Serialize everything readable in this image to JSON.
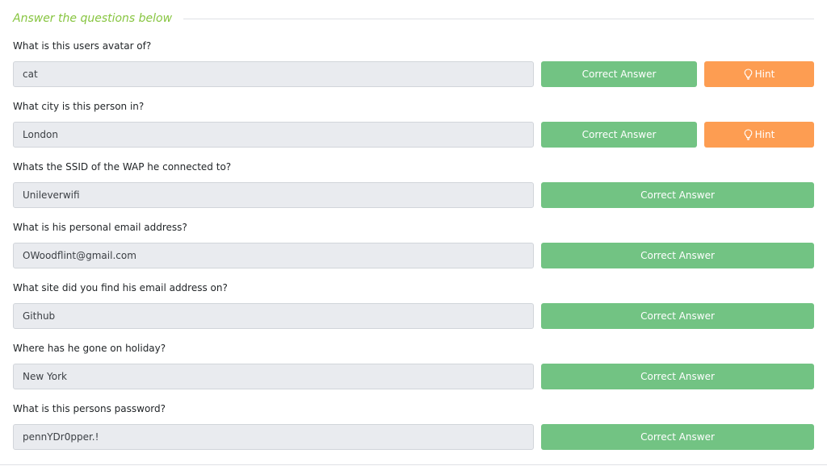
{
  "section": {
    "title": "Answer the questions below"
  },
  "colors": {
    "accent": "#87c540",
    "correct": "#72c383",
    "hint": "#fd9d52",
    "field_bg": "#e9ebef"
  },
  "questions": [
    {
      "text": "What is this users avatar of?",
      "answer": "cat",
      "correct_label": "Correct Answer",
      "hint_label": "Hint",
      "hint_icon": "lightbulb-icon"
    },
    {
      "text": "What city is this person in?",
      "answer": "London",
      "correct_label": "Correct Answer",
      "hint_label": "Hint",
      "hint_icon": "lightbulb-icon"
    },
    {
      "text": "Whats the SSID of the WAP he connected to?",
      "answer": "Unileverwifi",
      "correct_label": "Correct Answer"
    },
    {
      "text": "What is his personal email address?",
      "answer": "OWoodflint@gmail.com",
      "correct_label": "Correct Answer"
    },
    {
      "text": "What site did you find his email address on?",
      "answer": "Github",
      "correct_label": "Correct Answer"
    },
    {
      "text": "Where has he gone on holiday?",
      "answer": "New York",
      "correct_label": "Correct Answer"
    },
    {
      "text": "What is this persons password?",
      "answer": "pennYDr0pper.!",
      "correct_label": "Correct Answer"
    }
  ]
}
